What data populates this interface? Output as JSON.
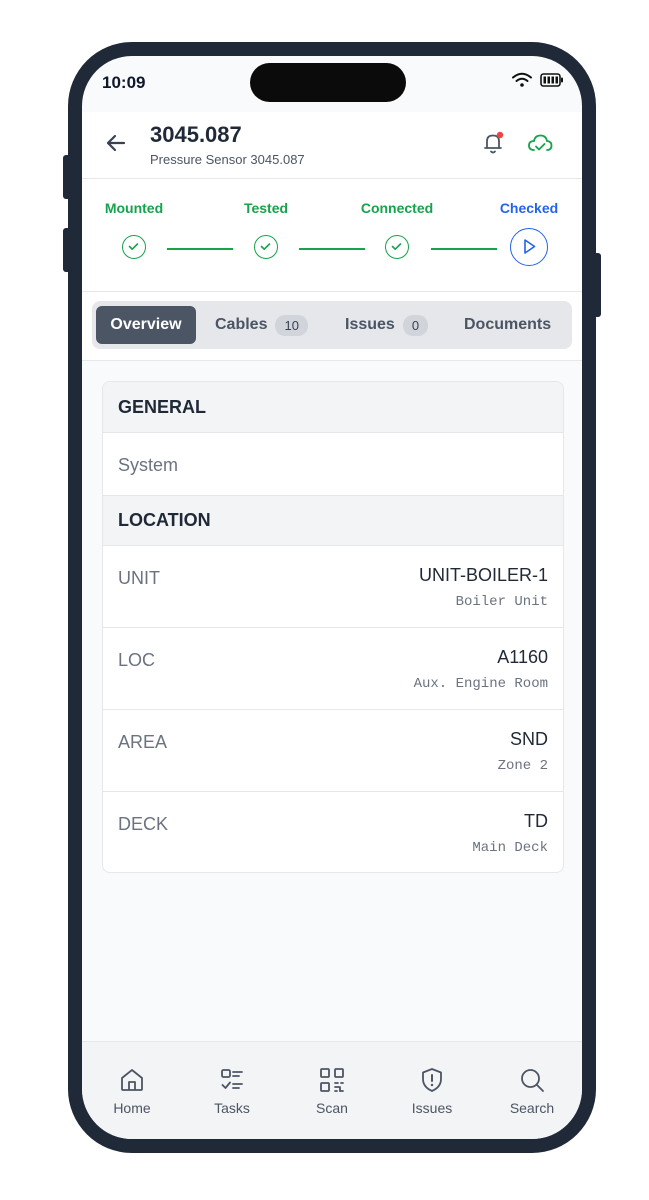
{
  "status_bar": {
    "time": "10:09"
  },
  "header": {
    "title": "3045.087",
    "subtitle": "Pressure Sensor 3045.087"
  },
  "steps": [
    {
      "label": "Mounted",
      "state": "done"
    },
    {
      "label": "Tested",
      "state": "done"
    },
    {
      "label": "Connected",
      "state": "done"
    },
    {
      "label": "Checked",
      "state": "current"
    }
  ],
  "colors": {
    "done": "#16a34a",
    "current": "#2563eb",
    "accent": "#4b5563"
  },
  "tabs": [
    {
      "label": "Overview"
    },
    {
      "label": "Cables",
      "count": "10"
    },
    {
      "label": "Issues",
      "count": "0"
    },
    {
      "label": "Documents"
    }
  ],
  "general": {
    "heading": "GENERAL",
    "system_label": "System"
  },
  "location": {
    "heading": "LOCATION",
    "rows": [
      {
        "key": "UNIT",
        "value": "UNIT-BOILER-1",
        "sub": "Boiler Unit"
      },
      {
        "key": "LOC",
        "value": "A1160",
        "sub": "Aux. Engine Room"
      },
      {
        "key": "AREA",
        "value": "SND",
        "sub": "Zone 2"
      },
      {
        "key": "DECK",
        "value": "TD",
        "sub": "Main Deck"
      }
    ]
  },
  "nav": [
    {
      "label": "Home",
      "icon": "home-icon"
    },
    {
      "label": "Tasks",
      "icon": "tasks-icon"
    },
    {
      "label": "Scan",
      "icon": "qr-code-icon"
    },
    {
      "label": "Issues",
      "icon": "shield-alert-icon"
    },
    {
      "label": "Search",
      "icon": "search-icon"
    }
  ]
}
